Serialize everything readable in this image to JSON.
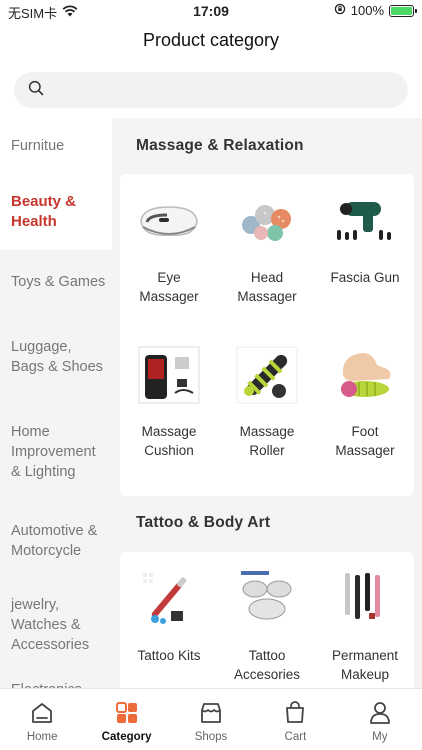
{
  "status_bar": {
    "carrier": "无SIM卡",
    "time": "17:09",
    "battery_percent": "100%",
    "battery_level": 1.0
  },
  "header": {
    "title": "Product category"
  },
  "search": {
    "placeholder": "",
    "icon": "search-icon"
  },
  "sidebar": {
    "items": [
      {
        "label": "Furnitue"
      },
      {
        "label": "Beauty & Health"
      },
      {
        "label": "Toys & Games"
      },
      {
        "label": "Luggage, Bags & Shoes"
      },
      {
        "label": "Home Improvement & Lighting"
      },
      {
        "label": "Automotive & Motorcycle"
      },
      {
        "label": "jewelry, Watches & Accessories"
      },
      {
        "label": "Electronics"
      }
    ]
  },
  "sections": [
    {
      "title": "Massage & Relaxation",
      "items": [
        {
          "label": "Eye Massager",
          "icon": "eye-massager-image"
        },
        {
          "label": "Head Massager",
          "icon": "head-massager-image"
        },
        {
          "label": "Fascia Gun",
          "icon": "fascia-gun-image"
        },
        {
          "label": "Massage Cushion",
          "icon": "massage-cushion-image"
        },
        {
          "label": "Massage Roller",
          "icon": "massage-roller-image"
        },
        {
          "label": "Foot Massager",
          "icon": "foot-massager-image"
        }
      ]
    },
    {
      "title": "Tattoo & Body Art",
      "items": [
        {
          "label": "Tattoo Kits",
          "icon": "tattoo-kits-image"
        },
        {
          "label": "Tattoo Accesories",
          "icon": "tattoo-accessories-image"
        },
        {
          "label": "Permanent Makeup",
          "icon": "permanent-makeup-image"
        }
      ]
    }
  ],
  "tabbar": {
    "tabs": [
      {
        "label": "Home",
        "icon": "home-icon"
      },
      {
        "label": "Category",
        "icon": "category-icon"
      },
      {
        "label": "Shops",
        "icon": "shop-icon"
      },
      {
        "label": "Cart",
        "icon": "cart-icon"
      },
      {
        "label": "My",
        "icon": "user-icon"
      }
    ]
  },
  "colors": {
    "accent": "#c8372d",
    "tab_active_orange": "#ef6b3a",
    "background": "#f4f4f4"
  }
}
